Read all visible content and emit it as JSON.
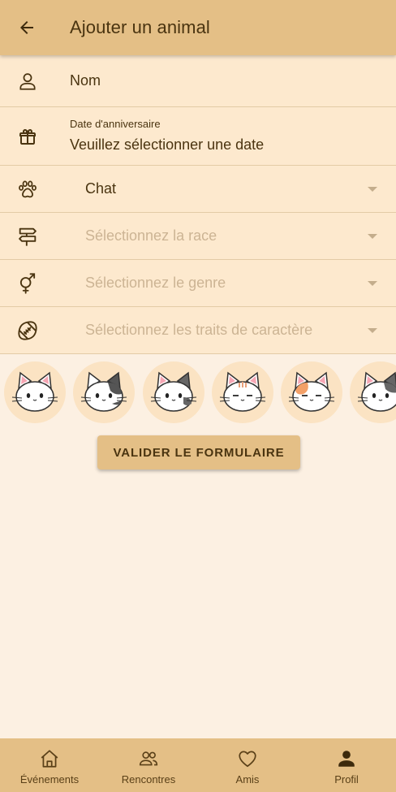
{
  "appbar": {
    "title": "Ajouter un animal",
    "back_icon": "arrow-left-icon"
  },
  "form": {
    "name": {
      "icon": "person-icon",
      "value": "Nom"
    },
    "birthday": {
      "icon": "gift-icon",
      "label": "Date d'anniversaire",
      "value": "Veuillez sélectionner une date"
    },
    "species": {
      "icon": "paw-icon",
      "value": "Chat"
    },
    "breed": {
      "icon": "signpost-icon",
      "placeholder": "Sélectionnez la race"
    },
    "gender": {
      "icon": "gender-icon",
      "placeholder": "Sélectionnez le genre"
    },
    "traits": {
      "icon": "football-icon",
      "placeholder": "Sélectionnez les traits de caractère"
    }
  },
  "avatars": [
    "cat-avatar-white-grey-ears",
    "cat-avatar-black-patch",
    "cat-avatar-grey-patch",
    "cat-avatar-tabby",
    "cat-avatar-orange-patch",
    "cat-avatar-calico"
  ],
  "submit_label": "VALIDER LE FORMULAIRE",
  "bottom_nav": {
    "events": {
      "label": "Événements",
      "icon": "home-icon"
    },
    "meetings": {
      "label": "Rencontres",
      "icon": "people-icon"
    },
    "friends": {
      "label": "Amis",
      "icon": "heart-icon"
    },
    "profile": {
      "label": "Profil",
      "icon": "person-filled-icon"
    }
  },
  "colors": {
    "primary": "#e4bf86",
    "form_background": "#fde9ce",
    "page_background": "#fcf0e2",
    "text": "#4a3410",
    "placeholder": "#ccb494"
  }
}
